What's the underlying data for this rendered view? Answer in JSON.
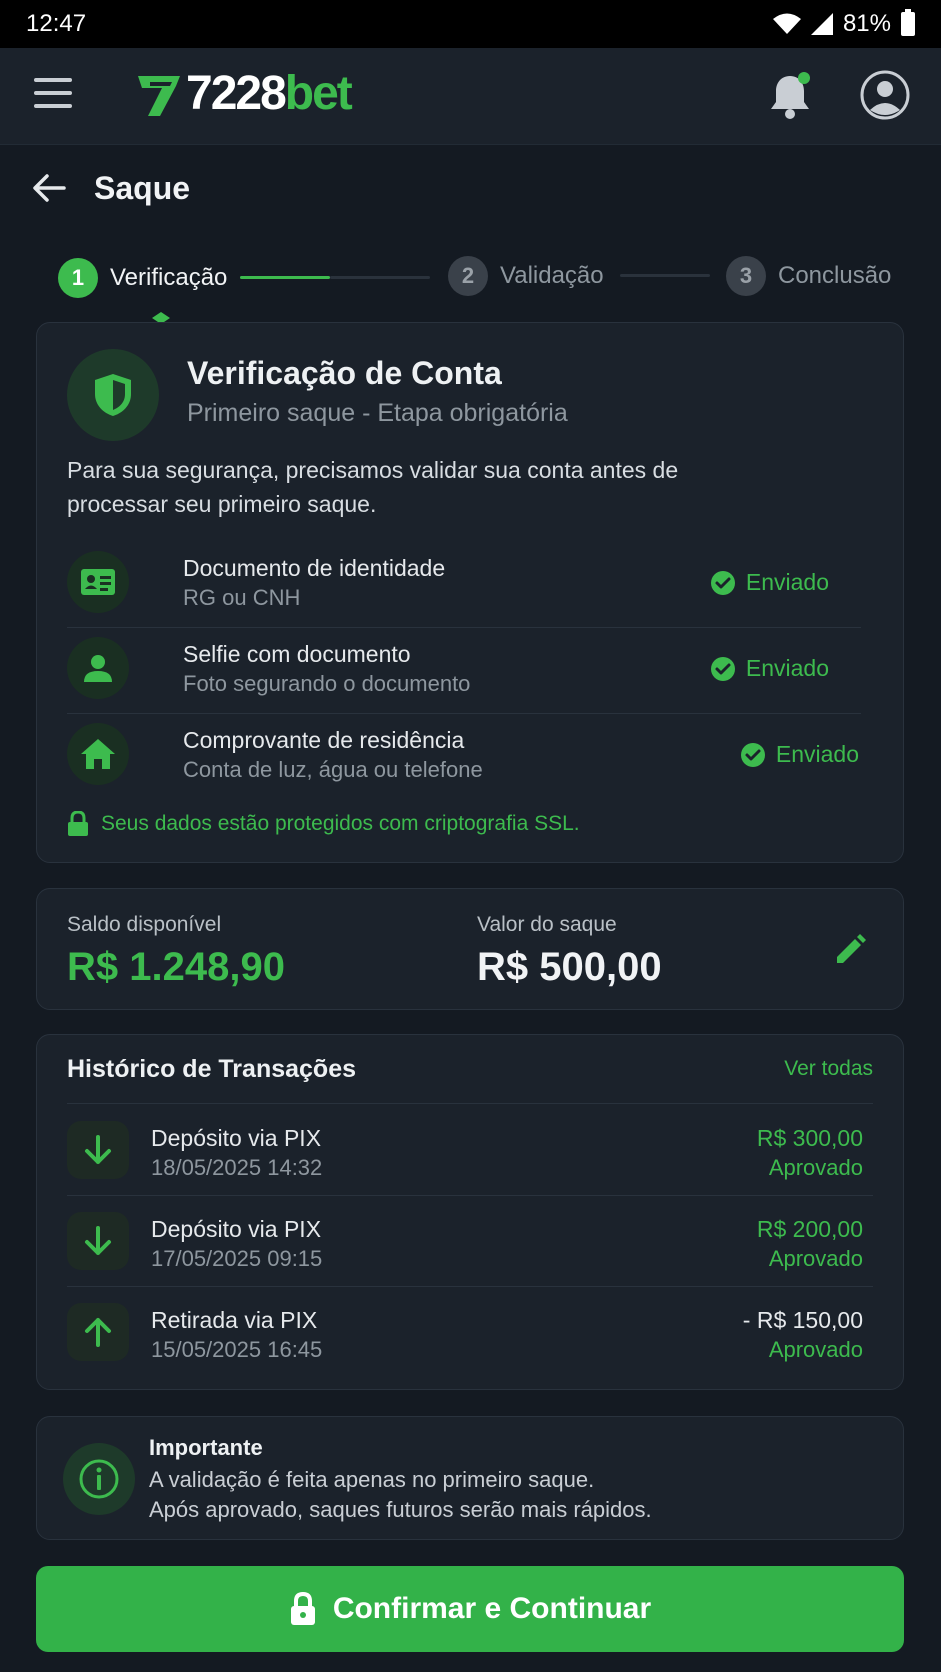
{
  "status_bar": {
    "time": "12:47",
    "battery": "81%"
  },
  "brand": {
    "name_white": "7228",
    "name_green": "bet"
  },
  "header": {
    "title": "Saque"
  },
  "stepper": {
    "steps": [
      {
        "number": "1",
        "label": "Verificação",
        "state": "active"
      },
      {
        "number": "2",
        "label": "Validação",
        "state": "pending"
      },
      {
        "number": "3",
        "label": "Conclusão",
        "state": "pending"
      }
    ]
  },
  "verification": {
    "title": "Verificação de Conta",
    "subtitle": "Primeiro saque - Etapa obrigatória",
    "description": "Para sua segurança, precisamos validar sua conta antes de processar seu primeiro saque.",
    "documents": [
      {
        "title": "Documento de identidade",
        "subtitle": "RG ou CNH",
        "status": "Enviado",
        "icon": "id-card-icon"
      },
      {
        "title": "Selfie com documento",
        "subtitle": "Foto segurando o documento",
        "status": "Enviado",
        "icon": "person-icon"
      },
      {
        "title": "Comprovante de residência",
        "subtitle": "Conta de luz, água ou telefone",
        "status": "Enviado",
        "icon": "home-icon"
      }
    ],
    "ssl_note": "Seus dados estão protegidos com criptografia SSL."
  },
  "balance": {
    "available_label": "Saldo disponível",
    "available_value": "R$ 1.248,90",
    "withdraw_label": "Valor do saque",
    "withdraw_value": "R$ 500,00"
  },
  "history": {
    "title": "Histórico de Transações",
    "see_all": "Ver todas",
    "transactions": [
      {
        "title": "Depósito via PIX",
        "date": "18/05/2025 14:32",
        "amount": "R$ 300,00",
        "status": "Aprovado",
        "direction": "in"
      },
      {
        "title": "Depósito via PIX",
        "date": "17/05/2025 09:15",
        "amount": "R$ 200,00",
        "status": "Aprovado",
        "direction": "in"
      },
      {
        "title": "Retirada via PIX",
        "date": "15/05/2025 16:45",
        "amount": "- R$ 150,00",
        "status": "Aprovado",
        "direction": "out"
      }
    ]
  },
  "info": {
    "title": "Importante",
    "line1": "A validação é feita apenas no primeiro saque.",
    "line2": "Após aprovado, saques futuros serão mais rápidos."
  },
  "cta": {
    "label": "Confirmar e Continuar"
  },
  "colors": {
    "accent": "#3dbb4e",
    "background": "#141a22",
    "card": "#1b222b",
    "button": "#33b249"
  }
}
